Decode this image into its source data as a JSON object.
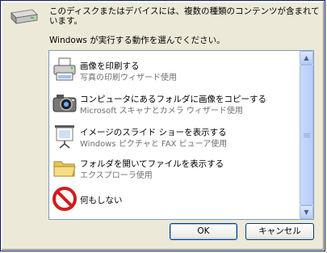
{
  "dialog": {
    "intro_text": "このディスクまたはデバイスには、複数の種類のコンテンツが含まれています。",
    "prompt_text": "Windows が実行する動作を選んでください。",
    "device_icon": "drive-icon"
  },
  "actions": [
    {
      "title": "画像を印刷する",
      "subtitle": "写真の印刷ウィザード使用",
      "icon": "printer-icon"
    },
    {
      "title": "コンピュータにあるフォルダに画像をコピーする",
      "subtitle": "Microsoft スキャナとカメラ ウィザード使用",
      "icon": "camera-icon"
    },
    {
      "title": "イメージのスライド ショーを表示する",
      "subtitle": "Windows ピクチャと FAX ビューア使用",
      "icon": "projector-screen-icon"
    },
    {
      "title": "フォルダを開いてファイルを表示する",
      "subtitle": "エクスプローラ使用",
      "icon": "folder-icon"
    },
    {
      "title": "何もしない",
      "subtitle": "",
      "icon": "no-action-icon"
    }
  ],
  "buttons": {
    "ok_label": "OK",
    "cancel_label": "キャンセル"
  },
  "colors": {
    "selection_border": "#316ac5",
    "list_border": "#7f9db9",
    "dialog_bg": "#ece9d8"
  }
}
